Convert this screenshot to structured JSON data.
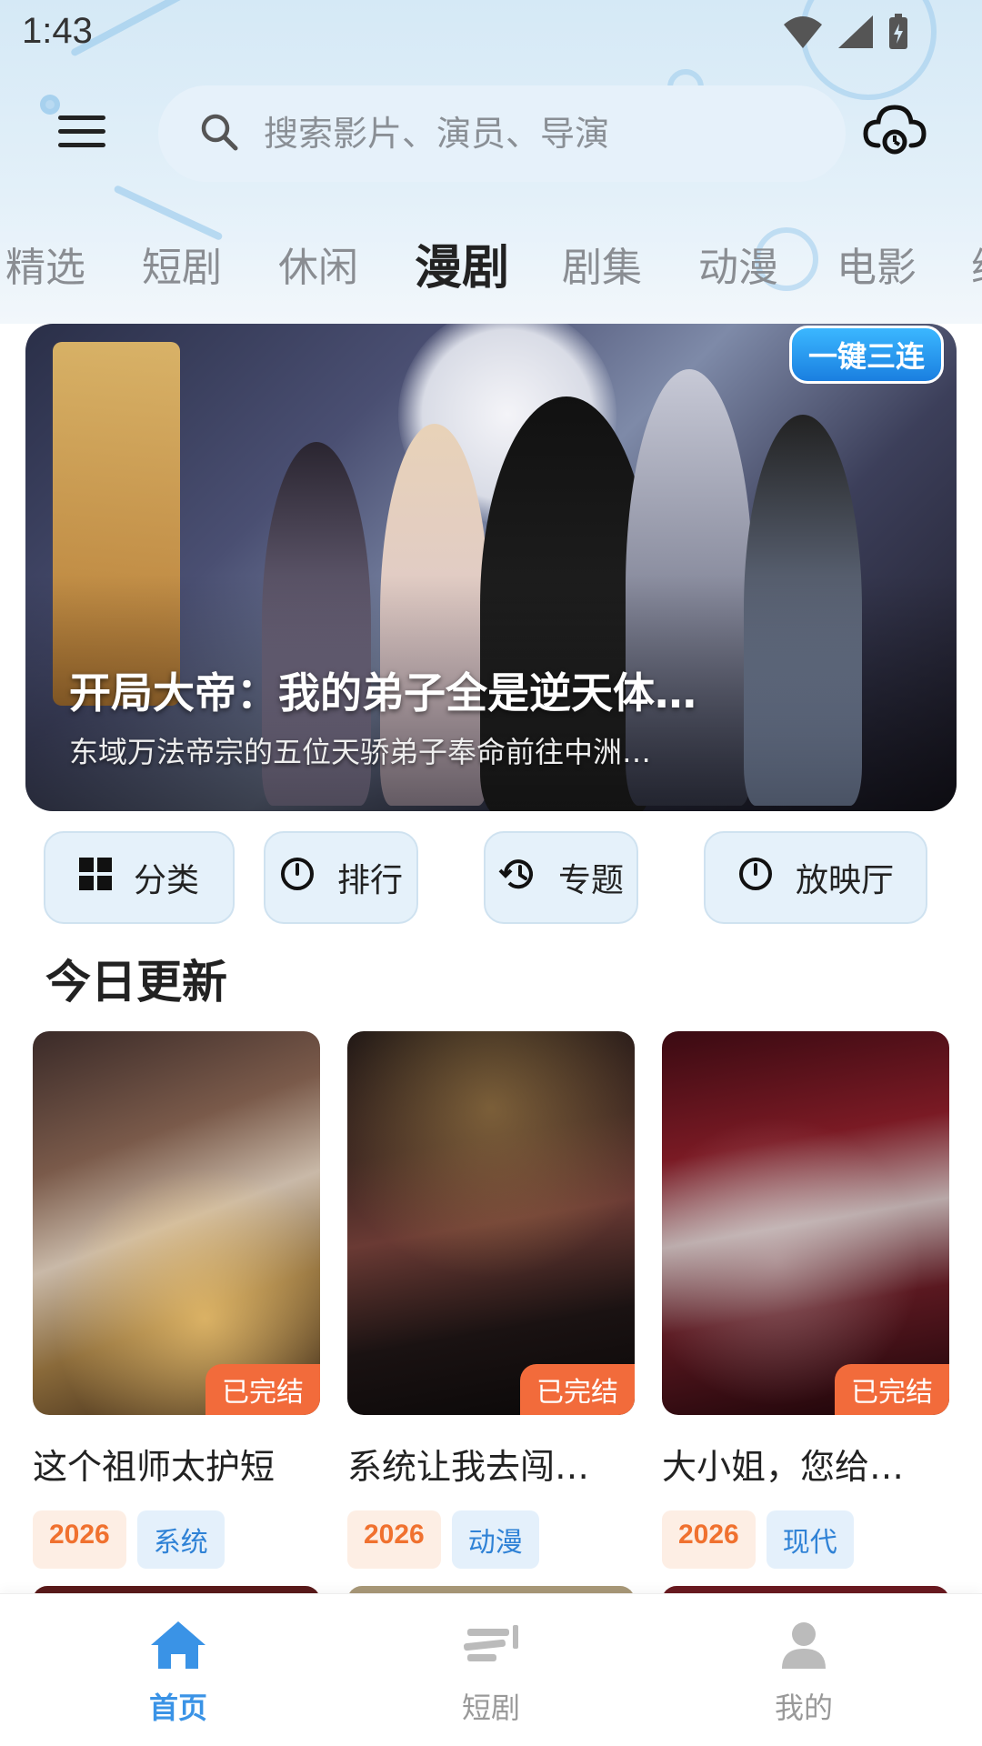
{
  "status_bar": {
    "time": "1:43"
  },
  "header": {
    "search_placeholder": "搜索影片、演员、导演"
  },
  "tabs": [
    {
      "label": "精选"
    },
    {
      "label": "短剧"
    },
    {
      "label": "休闲"
    },
    {
      "label": "漫剧",
      "active": true
    },
    {
      "label": "剧集"
    },
    {
      "label": "动漫"
    },
    {
      "label": "电影"
    },
    {
      "label": "综"
    }
  ],
  "banner": {
    "badge": "一键三连",
    "title": "开局大帝：我的弟子全是逆天体…",
    "description": "东域万法帝宗的五位天骄弟子奉命前往中洲…"
  },
  "quick_actions": [
    {
      "label": "分类",
      "icon": "grid-icon"
    },
    {
      "label": "排行",
      "icon": "clock-icon"
    },
    {
      "label": "专题",
      "icon": "history-icon"
    },
    {
      "label": "放映厅",
      "icon": "clock-icon"
    }
  ],
  "section": {
    "title": "今日更新"
  },
  "cards": [
    {
      "title": "这个祖师太护短",
      "status": "已完结",
      "year": "2026",
      "genre": "系统"
    },
    {
      "title": "系统让我去闯…",
      "status": "已完结",
      "year": "2026",
      "genre": "动漫"
    },
    {
      "title": "大小姐，您给…",
      "status": "已完结",
      "year": "2026",
      "genre": "现代"
    }
  ],
  "bottom_nav": [
    {
      "label": "首页",
      "icon": "home-icon",
      "active": true
    },
    {
      "label": "短剧",
      "icon": "short-drama-icon"
    },
    {
      "label": "我的",
      "icon": "profile-icon"
    }
  ],
  "colors": {
    "accent": "#3a93e6",
    "tag_orange": "#f0712f",
    "status_tag": "#f26b3b"
  }
}
